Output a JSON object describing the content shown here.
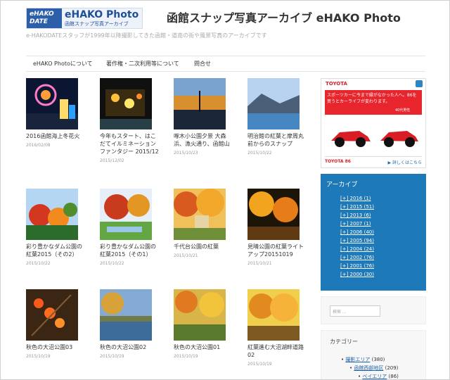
{
  "header": {
    "logo_badge": "eHAKO DATE",
    "logo_title": "eHAKO Photo",
    "logo_subtitle": "函館スナップ写真アーカイブ",
    "site_title": "函館スナップ写真アーカイブ eHAKO Photo",
    "site_description": "e-HAKODATEスタッフが1999年以降撮影してきた函館・道南の街や風景写真のアーカイブです"
  },
  "nav": {
    "items": [
      "eHAKO Photoについて",
      "著作権・二次利用等について",
      "問合せ"
    ]
  },
  "posts": [
    {
      "title": "2016函館海上冬花火",
      "date": "2016/02/08"
    },
    {
      "title": "今年もスタート、はこだてイルミネーションファンタジー 2015/12",
      "date": "2015/12/02"
    },
    {
      "title": "啄木小公園夕景 大森浜、漁火通り、函館山",
      "date": "2015/10/23"
    },
    {
      "title": "明治館の紅葉と摩周丸前からのスナップ",
      "date": "2015/10/22"
    },
    {
      "title": "彩り豊かなダム公園の紅葉2015（その2）",
      "date": "2015/10/22"
    },
    {
      "title": "彩り豊かなダム公園の紅葉2015（その1）",
      "date": "2015/10/22"
    },
    {
      "title": "千代台公園の紅葉",
      "date": "2015/10/21"
    },
    {
      "title": "見晴公園の紅葉ライトアップ20151019",
      "date": "2015/10/21"
    },
    {
      "title": "秋色の大沼公園03",
      "date": "2015/10/19"
    },
    {
      "title": "秋色の大沼公園02",
      "date": "2015/10/19"
    },
    {
      "title": "秋色の大沼公園01",
      "date": "2015/10/19"
    },
    {
      "title": "紅葉進む大沼湖畔道路02",
      "date": "2015/10/19"
    }
  ],
  "ad": {
    "brand": "TOYOTA",
    "headline": "スポーツカーに今まで縁がなかった人へ。86を買うとカーライフが変わります。",
    "badge": "40代男性",
    "footer_brand": "TOYOTA 86",
    "footer_link": "▶ 詳しくはこちら"
  },
  "archive": {
    "title": "アーカイブ",
    "items": [
      "[+] 2016 (1)",
      "[+] 2015 (51)",
      "[+] 2013 (6)",
      "[+] 2007 (1)",
      "[+] 2006 (40)",
      "[+] 2005 (94)",
      "[+] 2004 (24)",
      "[+] 2002 (76)",
      "[+] 2001 (76)",
      "[+] 2000 (30)"
    ]
  },
  "search": {
    "placeholder": "検索 ..."
  },
  "category": {
    "title": "カテゴリー",
    "items": [
      {
        "label": "撮影エリア",
        "count": "(380)"
      },
      {
        "label": "函館西部地区",
        "count": "(209)"
      },
      {
        "label": "ベイエリア",
        "count": "(86)"
      }
    ]
  },
  "colors": {
    "accent": "#1d79b7",
    "ad_red": "#e8242c"
  }
}
